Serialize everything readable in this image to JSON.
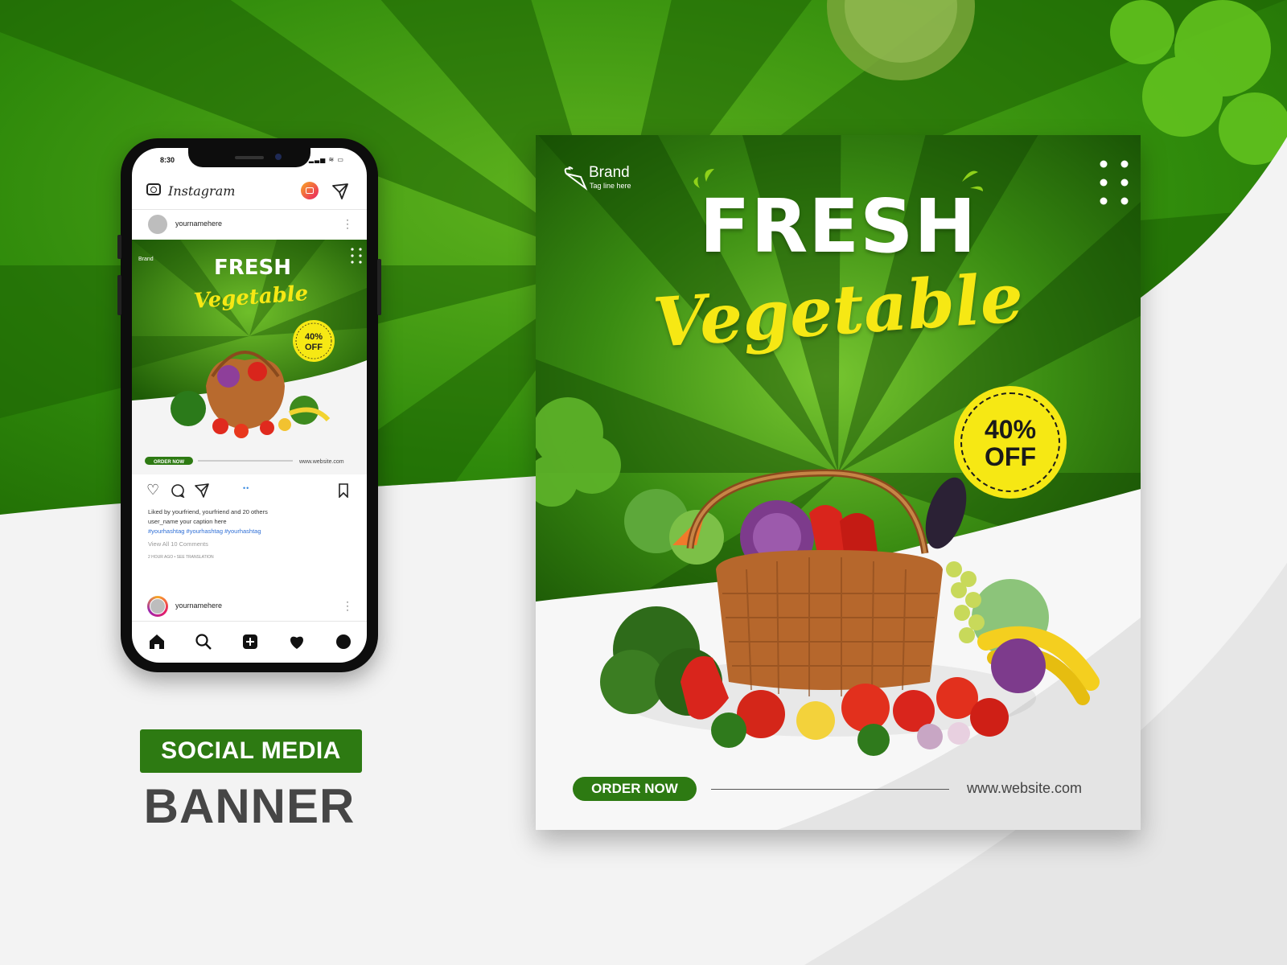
{
  "phone": {
    "status_time": "8:30",
    "status_icons": "▂▃▅ ≋ ▭",
    "app_name": "Instagram",
    "post_username": "yournamehere",
    "caption_likes": "Liked by yourfriend, yourfriend and 20 others",
    "caption_text": "user_name  your caption here",
    "caption_hashtags": "#yourhashtag #yourhashtag #yourhashtag",
    "caption_comments": "View All 10 Comments",
    "caption_time": "2 HOUR AGO  •  SEE TRANSLATION",
    "second_post_username": "yournamehere",
    "icons": [
      "camera-icon",
      "igtv-icon",
      "send-icon",
      "heart-icon",
      "comment-icon",
      "share-icon",
      "bookmark-icon",
      "home-icon",
      "search-icon",
      "add-post-icon",
      "activity-icon",
      "profile-icon"
    ]
  },
  "banner": {
    "brand_name": "Brand",
    "brand_tagline": "Tag line here",
    "headline": "FRESH",
    "subheadline": "Vegetable",
    "discount_percent": "40%",
    "discount_label": "OFF",
    "cta_label": "ORDER NOW",
    "website": "www.website.com"
  },
  "labels": {
    "social_media": "SOCIAL MEDIA",
    "banner": "BANNER"
  },
  "colors": {
    "green_dark": "#1f5e05",
    "green_mid": "#3f9c14",
    "green_accent": "#2d7a12",
    "yellow": "#f6e814",
    "text_dark": "#464646"
  }
}
